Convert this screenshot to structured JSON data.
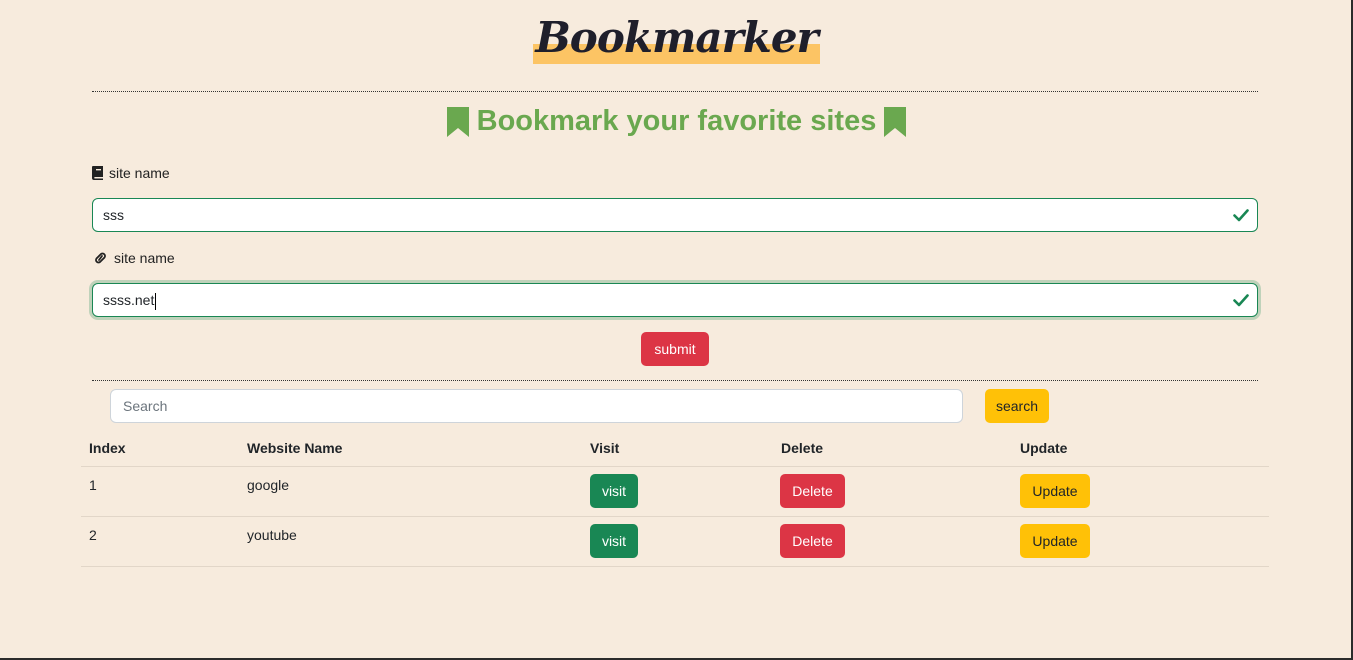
{
  "brand": {
    "title": "Bookmarker"
  },
  "form": {
    "headline": "Bookmark your favorite sites",
    "site_name_label": "site name",
    "site_name_value": "sss",
    "site_url_label": "site name",
    "site_url_value": "ssss.net",
    "submit_label": "submit"
  },
  "search": {
    "placeholder": "Search",
    "button_label": "search"
  },
  "table": {
    "headers": [
      "Index",
      "Website Name",
      "Visit",
      "Delete",
      "Update"
    ],
    "rows": [
      {
        "index": "1",
        "name": "google",
        "visit": "visit",
        "delete": "Delete",
        "update": "Update"
      },
      {
        "index": "2",
        "name": "youtube",
        "visit": "visit",
        "delete": "Delete",
        "update": "Update"
      }
    ]
  },
  "colors": {
    "background": "#f7ebdd",
    "brand_highlight": "#fcc464",
    "headline_green": "#6aa84f",
    "success": "#198754",
    "danger": "#dc3545",
    "warning": "#ffc107"
  },
  "icons": {
    "headline": "bookmark-icon",
    "site_name": "book-icon",
    "site_url": "link-icon",
    "valid": "check-icon"
  }
}
